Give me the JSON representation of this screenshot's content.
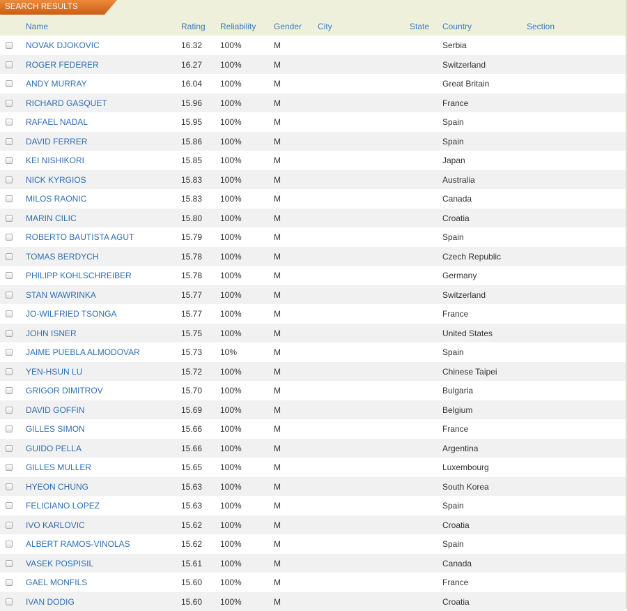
{
  "tab": {
    "label": "SEARCH RESULTS"
  },
  "colors": {
    "accent": "#d9711f",
    "link": "#2f6fb3",
    "header_bg": "#eef0dc"
  },
  "columns": {
    "name": "Name",
    "rating": "Rating",
    "reliability": "Reliability",
    "gender": "Gender",
    "city": "City",
    "state": "State",
    "country": "Country",
    "section": "Section"
  },
  "rows": [
    {
      "name": "NOVAK DJOKOVIC",
      "rating": "16.32",
      "reliability": "100%",
      "gender": "M",
      "country": "Serbia"
    },
    {
      "name": "ROGER FEDERER",
      "rating": "16.27",
      "reliability": "100%",
      "gender": "M",
      "country": "Switzerland"
    },
    {
      "name": "ANDY MURRAY",
      "rating": "16.04",
      "reliability": "100%",
      "gender": "M",
      "country": "Great Britain"
    },
    {
      "name": "RICHARD GASQUET",
      "rating": "15.96",
      "reliability": "100%",
      "gender": "M",
      "country": "France"
    },
    {
      "name": "RAFAEL NADAL",
      "rating": "15.95",
      "reliability": "100%",
      "gender": "M",
      "country": "Spain"
    },
    {
      "name": "DAVID FERRER",
      "rating": "15.86",
      "reliability": "100%",
      "gender": "M",
      "country": "Spain"
    },
    {
      "name": "KEI NISHIKORI",
      "rating": "15.85",
      "reliability": "100%",
      "gender": "M",
      "country": "Japan"
    },
    {
      "name": "NICK KYRGIOS",
      "rating": "15.83",
      "reliability": "100%",
      "gender": "M",
      "country": "Australia"
    },
    {
      "name": "MILOS RAONIC",
      "rating": "15.83",
      "reliability": "100%",
      "gender": "M",
      "country": "Canada"
    },
    {
      "name": "MARIN CILIC",
      "rating": "15.80",
      "reliability": "100%",
      "gender": "M",
      "country": "Croatia"
    },
    {
      "name": "ROBERTO BAUTISTA AGUT",
      "rating": "15.79",
      "reliability": "100%",
      "gender": "M",
      "country": "Spain"
    },
    {
      "name": "TOMAS BERDYCH",
      "rating": "15.78",
      "reliability": "100%",
      "gender": "M",
      "country": "Czech Republic"
    },
    {
      "name": "PHILIPP KOHLSCHREIBER",
      "rating": "15.78",
      "reliability": "100%",
      "gender": "M",
      "country": "Germany"
    },
    {
      "name": "STAN WAWRINKA",
      "rating": "15.77",
      "reliability": "100%",
      "gender": "M",
      "country": "Switzerland"
    },
    {
      "name": "JO-WILFRIED TSONGA",
      "rating": "15.77",
      "reliability": "100%",
      "gender": "M",
      "country": "France"
    },
    {
      "name": "JOHN ISNER",
      "rating": "15.75",
      "reliability": "100%",
      "gender": "M",
      "country": "United States"
    },
    {
      "name": "JAIME PUEBLA ALMODOVAR",
      "rating": "15.73",
      "reliability": "10%",
      "gender": "M",
      "country": "Spain"
    },
    {
      "name": "YEN-HSUN LU",
      "rating": "15.72",
      "reliability": "100%",
      "gender": "M",
      "country": "Chinese Taipei"
    },
    {
      "name": "GRIGOR DIMITROV",
      "rating": "15.70",
      "reliability": "100%",
      "gender": "M",
      "country": "Bulgaria"
    },
    {
      "name": "DAVID GOFFIN",
      "rating": "15.69",
      "reliability": "100%",
      "gender": "M",
      "country": "Belgium"
    },
    {
      "name": "GILLES SIMON",
      "rating": "15.66",
      "reliability": "100%",
      "gender": "M",
      "country": "France"
    },
    {
      "name": "GUIDO PELLA",
      "rating": "15.66",
      "reliability": "100%",
      "gender": "M",
      "country": "Argentina"
    },
    {
      "name": "GILLES MULLER",
      "rating": "15.65",
      "reliability": "100%",
      "gender": "M",
      "country": "Luxembourg"
    },
    {
      "name": "HYEON CHUNG",
      "rating": "15.63",
      "reliability": "100%",
      "gender": "M",
      "country": "South Korea"
    },
    {
      "name": "FELICIANO LOPEZ",
      "rating": "15.63",
      "reliability": "100%",
      "gender": "M",
      "country": "Spain"
    },
    {
      "name": "IVO KARLOVIC",
      "rating": "15.62",
      "reliability": "100%",
      "gender": "M",
      "country": "Croatia"
    },
    {
      "name": "ALBERT RAMOS-VINOLAS",
      "rating": "15.62",
      "reliability": "100%",
      "gender": "M",
      "country": "Spain"
    },
    {
      "name": "VASEK POSPISIL",
      "rating": "15.61",
      "reliability": "100%",
      "gender": "M",
      "country": "Canada"
    },
    {
      "name": "GAEL MONFILS",
      "rating": "15.60",
      "reliability": "100%",
      "gender": "M",
      "country": "France"
    },
    {
      "name": "IVAN DODIG",
      "rating": "15.60",
      "reliability": "100%",
      "gender": "M",
      "country": "Croatia"
    }
  ]
}
